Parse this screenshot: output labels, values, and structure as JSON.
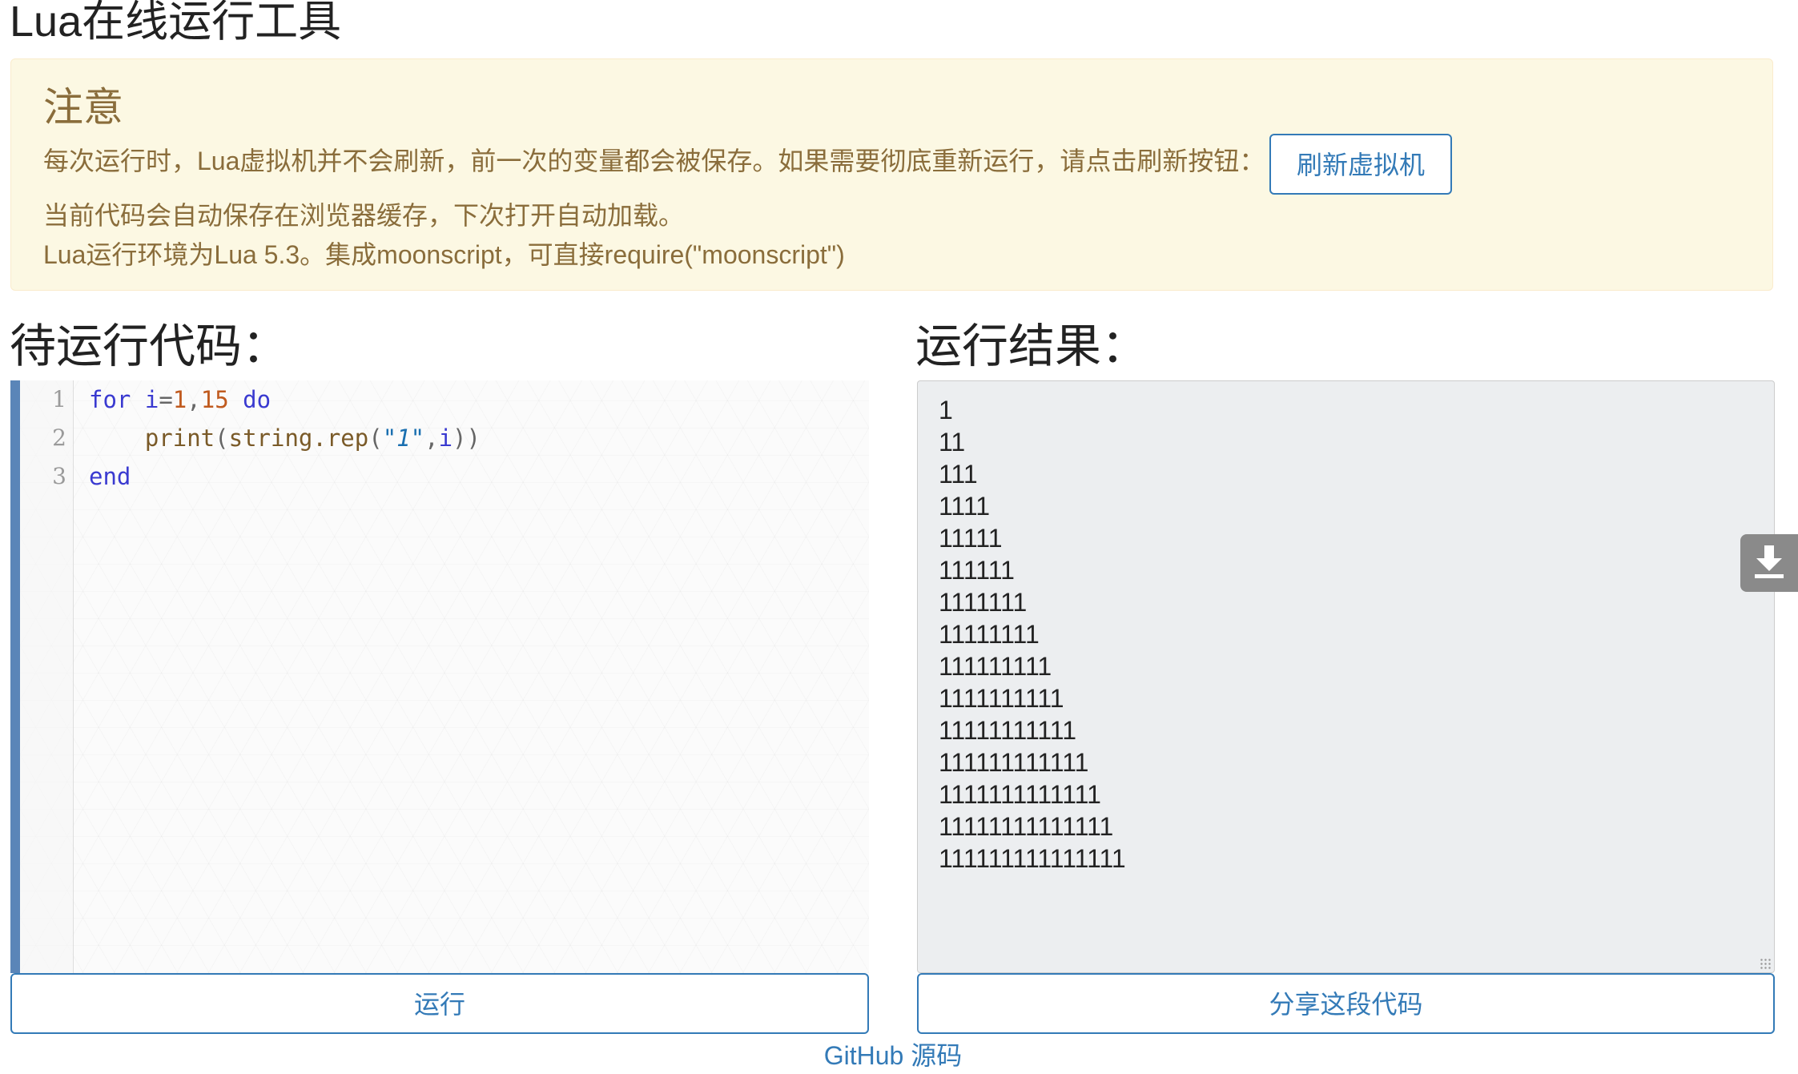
{
  "page": {
    "title": "Lua在线运行工具"
  },
  "notice": {
    "heading": "注意",
    "line1": "每次运行时，Lua虚拟机并不会刷新，前一次的变量都会被保存。如果需要彻底重新运行，请点击刷新按钮：",
    "refresh_button_label": "刷新虚拟机",
    "line2": "当前代码会自动保存在浏览器缓存，下次打开自动加载。",
    "line3": "Lua运行环境为Lua 5.3。集成moonscript，可直接require(\"moonscript\")"
  },
  "editor": {
    "heading": "待运行代码：",
    "line_numbers": [
      "1",
      "2",
      "3"
    ],
    "lines": [
      [
        {
          "text": "for",
          "kind": "kw"
        },
        {
          "text": " ",
          "kind": "plain"
        },
        {
          "text": "i",
          "kind": "id"
        },
        {
          "text": "=",
          "kind": "punct"
        },
        {
          "text": "1",
          "kind": "num"
        },
        {
          "text": ",",
          "kind": "punct"
        },
        {
          "text": "15",
          "kind": "num"
        },
        {
          "text": " ",
          "kind": "plain"
        },
        {
          "text": "do",
          "kind": "kw"
        }
      ],
      [
        {
          "text": "    ",
          "kind": "plain"
        },
        {
          "text": "print",
          "kind": "fn"
        },
        {
          "text": "(",
          "kind": "punct"
        },
        {
          "text": "string.rep",
          "kind": "fn"
        },
        {
          "text": "(",
          "kind": "punct"
        },
        {
          "text": "\"1\"",
          "kind": "str"
        },
        {
          "text": ",",
          "kind": "punct"
        },
        {
          "text": "i",
          "kind": "id"
        },
        {
          "text": "))",
          "kind": "punct"
        }
      ],
      [
        {
          "text": "end",
          "kind": "kw"
        }
      ]
    ]
  },
  "result": {
    "heading": "运行结果：",
    "lines": [
      "1",
      "11",
      "111",
      "1111",
      "11111",
      "111111",
      "1111111",
      "11111111",
      "111111111",
      "1111111111",
      "11111111111",
      "111111111111",
      "1111111111111",
      "11111111111111",
      "111111111111111"
    ]
  },
  "actions": {
    "run_label": "运行",
    "share_label": "分享这段代码"
  },
  "footer": {
    "github_link": "GitHub 源码"
  },
  "icons": {
    "download_tab": "download-icon"
  },
  "colors": {
    "accent": "#337ab7",
    "notice_bg": "#fcf8e3",
    "notice_text": "#8a6d3b",
    "editor_bar": "#5a85b8",
    "result_bg": "#eceef0"
  }
}
